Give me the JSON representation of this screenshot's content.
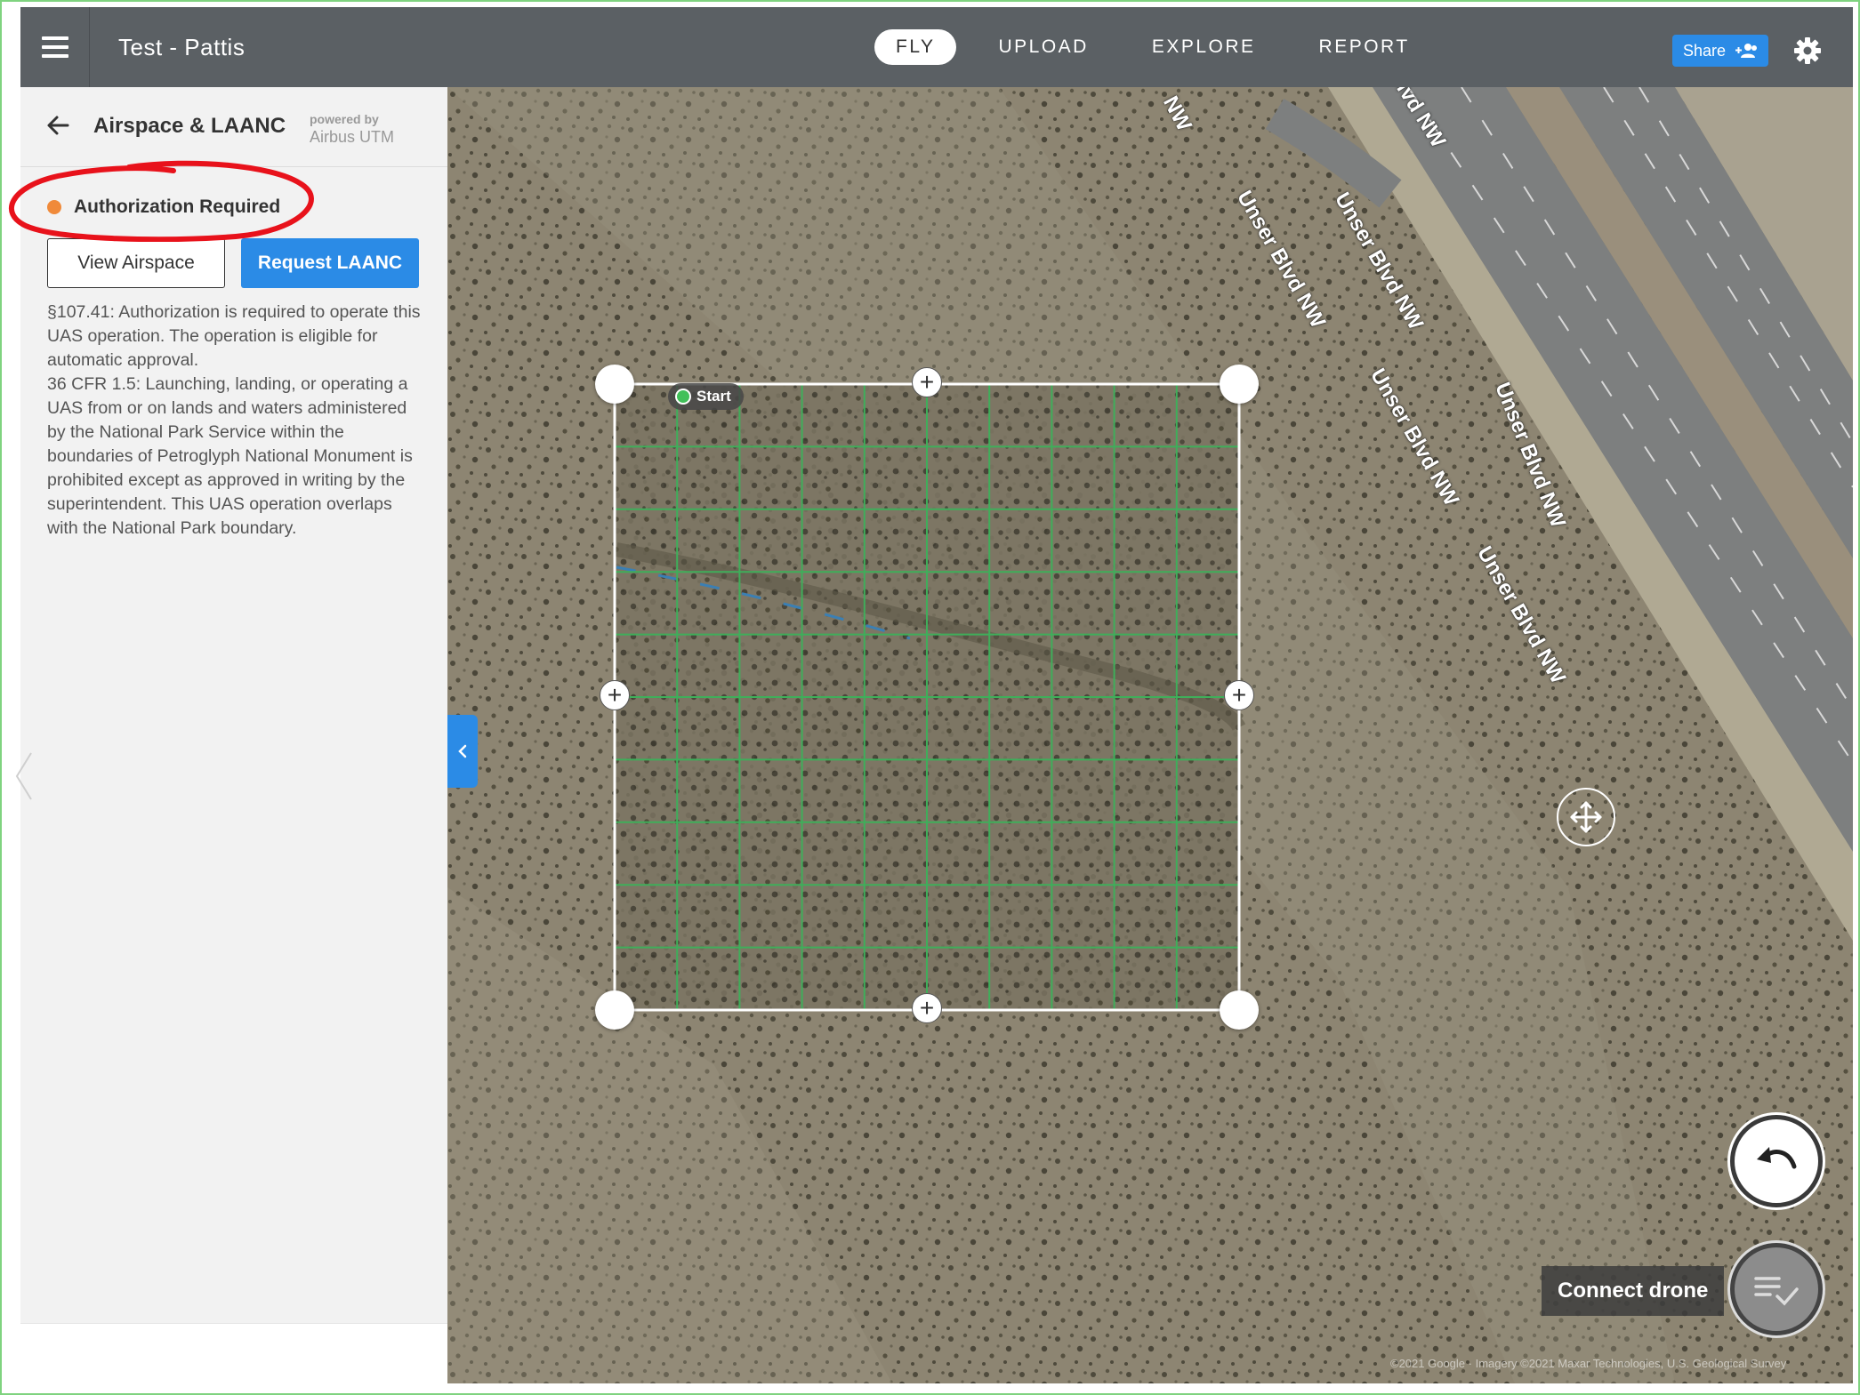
{
  "header": {
    "project_title": "Test - Pattis",
    "tabs": [
      {
        "label": "FLY",
        "active": true
      },
      {
        "label": "UPLOAD",
        "active": false
      },
      {
        "label": "EXPLORE",
        "active": false
      },
      {
        "label": "REPORT",
        "active": false
      }
    ],
    "share_label": "Share",
    "icons": [
      "menu-icon",
      "add-people-icon",
      "gear-icon"
    ]
  },
  "panel": {
    "title": "Airspace & LAANC",
    "powered_by": "powered by",
    "powered_by_brand": "Airbus UTM",
    "auth_status": "Authorization Required",
    "auth_status_color": "#f08a3a",
    "view_airspace_label": "View Airspace",
    "request_laanc_label": "Request LAANC",
    "auth_text": "§107.41: Authorization is required to operate this UAS operation. The operation is eligible for automatic approval.\n36 CFR 1.5: Launching, landing, or operating a UAS from or on lands and waters administered by the National Park Service within the boundaries of Petroglyph National Monument is prohibited except as approved in writing by the superintendent. This UAS operation overlaps with the National Park boundary."
  },
  "map": {
    "start_label": "Start",
    "connect_drone_label": "Connect drone",
    "attribution": "©2021 Google · Imagery ©2021 Maxar Technologies, U.S. Geological Survey",
    "road_labels": [
      "NW",
      "Blvd NW",
      "Unser Blvd NW",
      "Unser Blvd NW",
      "Unser Blvd NW",
      "Unser Blvd NW",
      "Unser Blvd NW"
    ],
    "grid_color": "#3fae5a",
    "accent": "#2b8be6"
  }
}
